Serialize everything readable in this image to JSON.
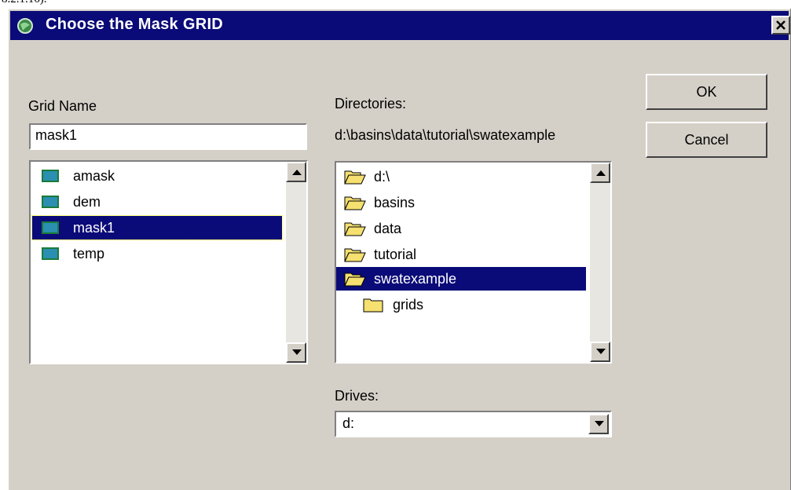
{
  "dialog": {
    "title": "Choose the Mask GRID",
    "ok_label": "OK",
    "cancel_label": "Cancel"
  },
  "grid": {
    "label": "Grid Name",
    "value": "mask1",
    "items": [
      "amask",
      "dem",
      "mask1",
      "temp"
    ],
    "selected": "mask1"
  },
  "directories": {
    "label": "Directories:",
    "path": "d:\\basins\\data\\tutorial\\swatexample",
    "items": [
      "d:\\",
      "basins",
      "data",
      "tutorial",
      "swatexample",
      "grids"
    ],
    "selected": "swatexample"
  },
  "drives": {
    "label": "Drives:",
    "value": "d:"
  },
  "colors": {
    "titlebar": "#0a0a78",
    "selection": "#0a0a78",
    "dialog_face": "#d4d0c8",
    "grid_icon": "#2a8fb0",
    "folder": "#f5e070"
  }
}
